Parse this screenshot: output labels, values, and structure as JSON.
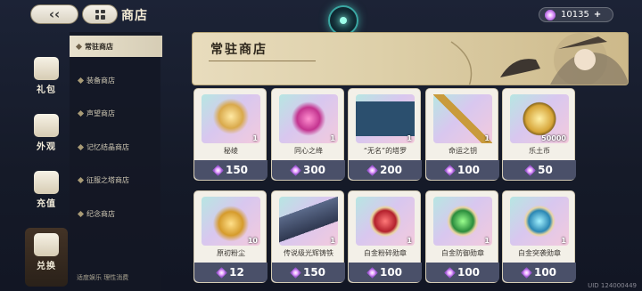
{
  "header": {
    "title": "商店",
    "currency_value": "10135"
  },
  "left_nav": {
    "items": [
      {
        "label": "礼包"
      },
      {
        "label": "外观"
      },
      {
        "label": "充值"
      },
      {
        "label": "兑换"
      }
    ]
  },
  "sub_nav": {
    "items": [
      {
        "label": "常驻商店"
      },
      {
        "label": "装备商店"
      },
      {
        "label": "声望商店"
      },
      {
        "label": "记忆结晶商店"
      },
      {
        "label": "征服之塔商店"
      },
      {
        "label": "纪念商店"
      }
    ],
    "footer": "适度娱乐 理性消费"
  },
  "banner": {
    "title": "常驻商店"
  },
  "items": [
    {
      "name": "秘绫",
      "qty": "1",
      "price": "150",
      "icon": "golden-lantern-icon"
    },
    {
      "name": "同心之绛",
      "qty": "1",
      "price": "300",
      "icon": "heart-gem-icon"
    },
    {
      "name": "“无名”的塔罗",
      "qty": "1",
      "price": "200",
      "icon": "tarot-card-icon"
    },
    {
      "name": "命运之钥",
      "qty": "1",
      "price": "100",
      "icon": "golden-key-icon"
    },
    {
      "name": "乐土币",
      "qty": "50000",
      "price": "50",
      "icon": "gold-coin-icon"
    },
    {
      "name": "原初粉尘",
      "qty": "10",
      "price": "12",
      "icon": "dust-flask-icon"
    },
    {
      "name": "传说级光辉铸铁",
      "qty": "1",
      "price": "150",
      "icon": "crystal-ore-icon"
    },
    {
      "name": "白金粉碎勋章",
      "qty": "1",
      "price": "100",
      "icon": "red-medal-icon"
    },
    {
      "name": "白金防御勋章",
      "qty": "1",
      "price": "100",
      "icon": "green-medal-icon"
    },
    {
      "name": "白金突袭勋章",
      "qty": "1",
      "price": "100",
      "icon": "blue-medal-icon"
    }
  ],
  "uid": "UID 124000449",
  "colors": {
    "price_bar": "#4a5069",
    "card_bg": "#f3f0e8",
    "accent_gem": "#c27be6"
  }
}
